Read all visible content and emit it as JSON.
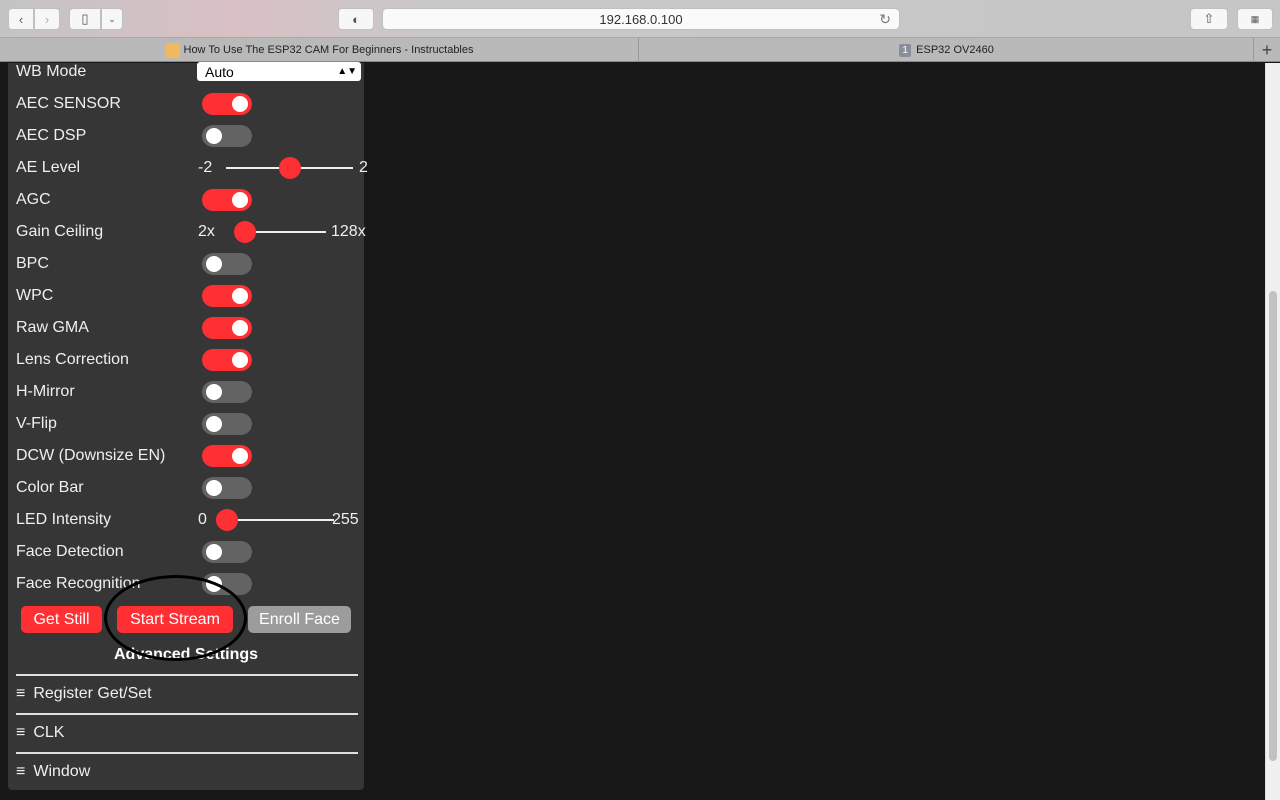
{
  "browser": {
    "url": "192.168.0.100",
    "tabs": [
      {
        "label": "How To Use The ESP32 CAM For Beginners - Instructables",
        "active": false
      },
      {
        "label": "ESP32 OV2460",
        "badge": "1",
        "active": true
      }
    ]
  },
  "settings": [
    {
      "label": "WB Mode",
      "type": "select",
      "value": "Auto"
    },
    {
      "label": "AEC SENSOR",
      "type": "toggle",
      "on": true
    },
    {
      "label": "AEC DSP",
      "type": "toggle",
      "on": false
    },
    {
      "label": "AE Level",
      "type": "range",
      "min": "-2",
      "max": "2",
      "value": 0
    },
    {
      "label": "AGC",
      "type": "toggle",
      "on": true
    },
    {
      "label": "Gain Ceiling",
      "type": "range",
      "min": "2x",
      "max": "128x",
      "value": 0
    },
    {
      "label": "BPC",
      "type": "toggle",
      "on": false
    },
    {
      "label": "WPC",
      "type": "toggle",
      "on": true
    },
    {
      "label": "Raw GMA",
      "type": "toggle",
      "on": true
    },
    {
      "label": "Lens Correction",
      "type": "toggle",
      "on": true
    },
    {
      "label": "H-Mirror",
      "type": "toggle",
      "on": false
    },
    {
      "label": "V-Flip",
      "type": "toggle",
      "on": false
    },
    {
      "label": "DCW (Downsize EN)",
      "type": "toggle",
      "on": true
    },
    {
      "label": "Color Bar",
      "type": "toggle",
      "on": false
    },
    {
      "label": "LED Intensity",
      "type": "range",
      "min": "0",
      "max": "255",
      "value": 0
    },
    {
      "label": "Face Detection",
      "type": "toggle",
      "on": false
    },
    {
      "label": "Face Recognition",
      "type": "toggle",
      "on": false
    }
  ],
  "buttons": {
    "get_still": "Get Still",
    "start_stream": "Start Stream",
    "enroll_face": "Enroll Face"
  },
  "advanced": {
    "title": "Advanced Settings",
    "sections": [
      "Register Get/Set",
      "CLK",
      "Window"
    ]
  },
  "colors": {
    "accent": "#ff3034",
    "panel": "#363636",
    "background": "#181818"
  }
}
